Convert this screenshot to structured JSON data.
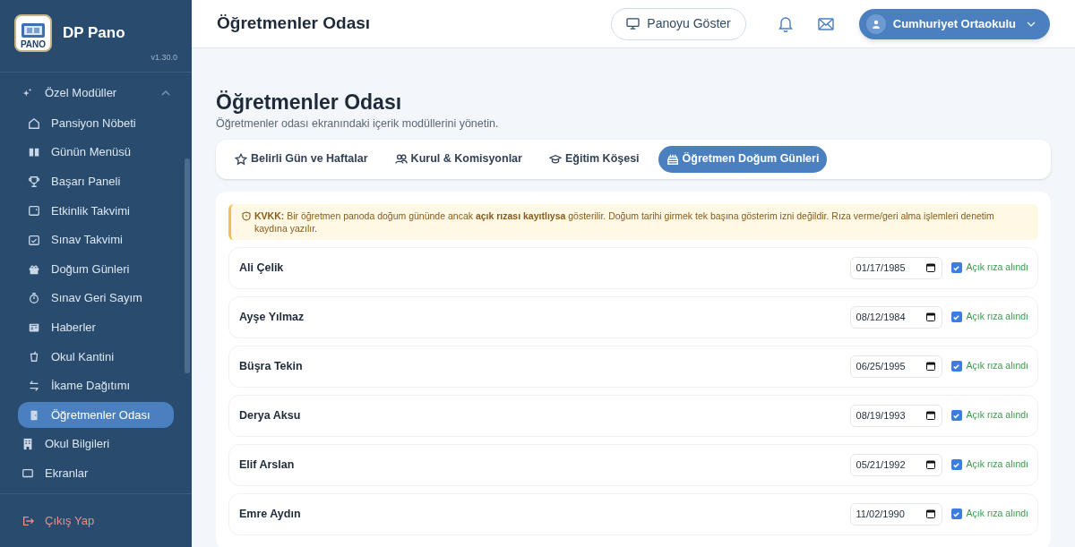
{
  "app": {
    "name": "DP Pano",
    "logo_text": "PANO",
    "version": "v1.30.0"
  },
  "sidebar": {
    "group": {
      "label": "Özel Modüller",
      "expanded": true,
      "children": [
        {
          "label": "Pansiyon Nöbeti",
          "selected": false
        },
        {
          "label": "Günün Menüsü",
          "selected": false
        },
        {
          "label": "Başarı Paneli",
          "selected": false
        },
        {
          "label": "Etkinlik Takvimi",
          "selected": false
        },
        {
          "label": "Sınav Takvimi",
          "selected": false
        },
        {
          "label": "Doğum Günleri",
          "selected": false
        },
        {
          "label": "Sınav Geri Sayım",
          "selected": false
        },
        {
          "label": "Haberler",
          "selected": false
        },
        {
          "label": "Okul Kantini",
          "selected": false
        },
        {
          "label": "İkame Dağıtımı",
          "selected": false
        },
        {
          "label": "Öğretmenler Odası",
          "selected": true
        }
      ]
    },
    "items": [
      {
        "label": "Okul Bilgileri"
      },
      {
        "label": "Ekranlar"
      }
    ],
    "logout": "Çıkış Yap"
  },
  "header": {
    "title": "Öğretmenler Odası",
    "show_board": "Panoyu Göster",
    "account": "Cumhuriyet Ortaokulu"
  },
  "page": {
    "title": "Öğretmenler Odası",
    "subtitle": "Öğretmenler odası ekranındaki içerik modüllerini yönetin."
  },
  "tabs": [
    {
      "label": "Belirli Gün ve Haftalar",
      "selected": false
    },
    {
      "label": "Kurul & Komisyonlar",
      "selected": false
    },
    {
      "label": "Eğitim Köşesi",
      "selected": false
    },
    {
      "label": "Öğretmen Doğum Günleri",
      "selected": true
    }
  ],
  "notice": "**KVKK:** Bir öğretmen panoda doğum gününde ancak **açık rızası kayıtlıysa** gösterilir. Doğum tarihi girmek tek başına gösterim izni değildir. Rıza verme/geri alma işlemleri denetim kaydına yazılır.",
  "teachers": [
    {
      "name": "Ali Çelik",
      "birth_date": "01/17/1985",
      "consent": "Açık rıza alındı",
      "checked": true
    },
    {
      "name": "Ayşe Yılmaz",
      "birth_date": "08/12/1984",
      "consent": "Açık rıza alındı",
      "checked": true
    },
    {
      "name": "Büşra Tekin",
      "birth_date": "06/25/1995",
      "consent": "Açık rıza alındı",
      "checked": true
    },
    {
      "name": "Derya Aksu",
      "birth_date": "08/19/1993",
      "consent": "Açık rıza alındı",
      "checked": true
    },
    {
      "name": "Elif Arslan",
      "birth_date": "05/21/1992",
      "consent": "Açık rıza alındı",
      "checked": true
    },
    {
      "name": "Emre Aydın",
      "birth_date": "11/02/1990",
      "consent": "Açık rıza alındı",
      "checked": true
    }
  ]
}
